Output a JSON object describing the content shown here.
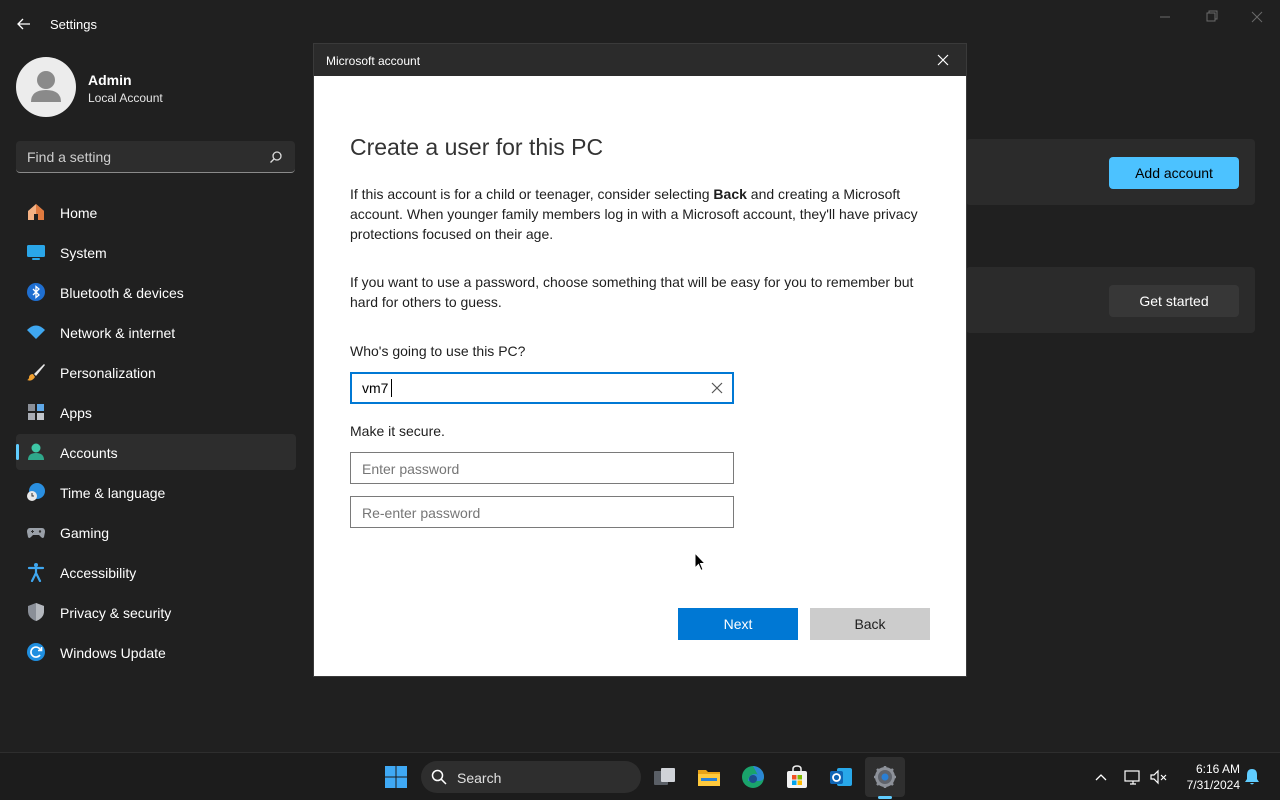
{
  "window": {
    "title": "Settings"
  },
  "profile": {
    "name": "Admin",
    "account_type": "Local Account"
  },
  "search": {
    "placeholder": "Find a setting"
  },
  "sidebar": {
    "items": [
      {
        "label": "Home",
        "icon": "home-icon"
      },
      {
        "label": "System",
        "icon": "system-icon"
      },
      {
        "label": "Bluetooth & devices",
        "icon": "bluetooth-icon"
      },
      {
        "label": "Network & internet",
        "icon": "wifi-icon"
      },
      {
        "label": "Personalization",
        "icon": "brush-icon"
      },
      {
        "label": "Apps",
        "icon": "apps-icon"
      },
      {
        "label": "Accounts",
        "icon": "accounts-icon",
        "active": true
      },
      {
        "label": "Time & language",
        "icon": "clock-globe-icon"
      },
      {
        "label": "Gaming",
        "icon": "gamepad-icon"
      },
      {
        "label": "Accessibility",
        "icon": "accessibility-icon"
      },
      {
        "label": "Privacy & security",
        "icon": "shield-icon"
      },
      {
        "label": "Windows Update",
        "icon": "update-icon"
      }
    ]
  },
  "main": {
    "add_account_label": "Add account",
    "get_started_label": "Get started"
  },
  "dialog": {
    "title": "Microsoft account",
    "heading": "Create a user for this PC",
    "para1_before": "If this account is for a child or teenager, consider selecting ",
    "para1_bold": "Back",
    "para1_after": " and creating a Microsoft account. When younger family members log in with a Microsoft account, they'll have privacy protections focused on their age.",
    "para2": "If you want to use a password, choose something that will be easy for you to remember but hard for others to guess.",
    "who_label": "Who's going to use this PC?",
    "username_value": "vm7",
    "secure_label": "Make it secure.",
    "password_placeholder": "Enter password",
    "reenter_placeholder": "Re-enter password",
    "next_label": "Next",
    "back_label": "Back"
  },
  "taskbar": {
    "search_label": "Search",
    "time": "6:16 AM",
    "date": "7/31/2024"
  },
  "colors": {
    "accent": "#0078d4",
    "accent_light": "#4cc2ff",
    "background": "#202020"
  }
}
